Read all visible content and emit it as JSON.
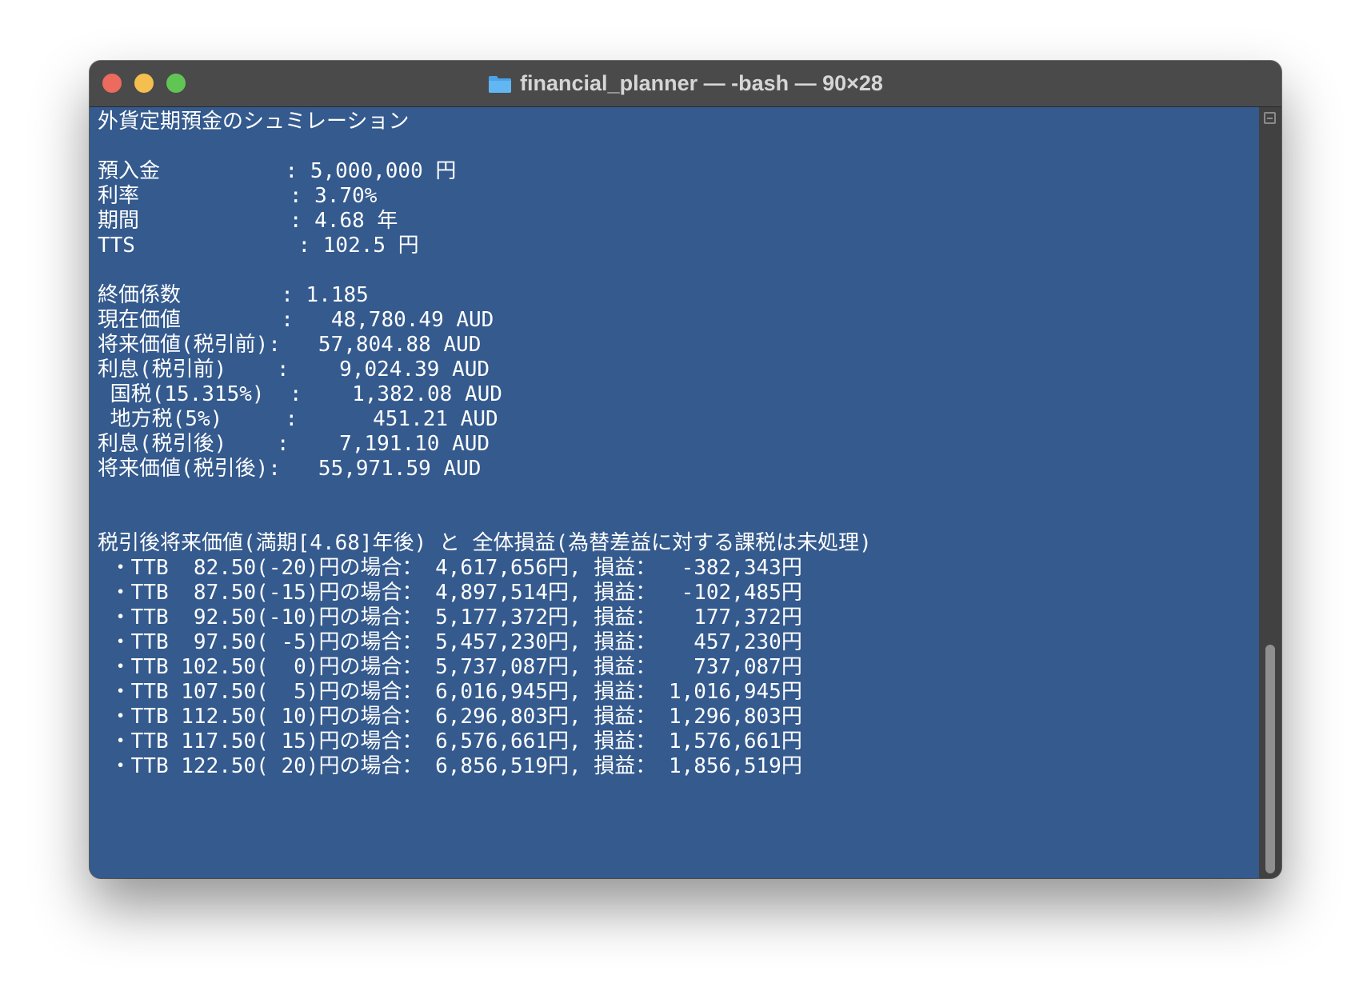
{
  "window": {
    "title": "financial_planner — -bash — 90×28"
  },
  "terminal": {
    "lines": [
      "外貨定期預金のシュミレーション",
      "",
      "預入金          : 5,000,000 円",
      "利率            : 3.70%",
      "期間            : 4.68 年",
      "TTS             : 102.5 円",
      "",
      "終価係数        : 1.185",
      "現在価値        :   48,780.49 AUD",
      "将来価値(税引前):   57,804.88 AUD",
      "利息(税引前)    :    9,024.39 AUD",
      " 国税(15.315%)  :    1,382.08 AUD",
      " 地方税(5%)     :      451.21 AUD",
      "利息(税引後)    :    7,191.10 AUD",
      "将来価値(税引後):   55,971.59 AUD",
      "",
      "",
      "税引後将来価値(満期[4.68]年後) と 全体損益(為替差益に対する課税は未処理)",
      " ・TTB  82.50(-20)円の場合： 4,617,656円, 損益：  -382,343円",
      " ・TTB  87.50(-15)円の場合： 4,897,514円, 損益：  -102,485円",
      " ・TTB  92.50(-10)円の場合： 5,177,372円, 損益：   177,372円",
      " ・TTB  97.50( -5)円の場合： 5,457,230円, 損益：   457,230円",
      " ・TTB 102.50(  0)円の場合： 5,737,087円, 損益：   737,087円",
      " ・TTB 107.50(  5)円の場合： 6,016,945円, 損益： 1,016,945円",
      " ・TTB 112.50( 10)円の場合： 6,296,803円, 損益： 1,296,803円",
      " ・TTB 117.50( 15)円の場合： 6,576,661円, 損益： 1,576,661円",
      " ・TTB 122.50( 20)円の場合： 6,856,519円, 損益： 1,856,519円"
    ]
  },
  "icons": {
    "folder": "folder-icon",
    "scroll_split": "split-pane-icon"
  },
  "colors": {
    "background": "#345a8e",
    "titlebar": "#4a4a4a",
    "text": "#ffffff",
    "close": "#ed6a5e",
    "minimize": "#f5bf4f",
    "zoom": "#61c554"
  }
}
